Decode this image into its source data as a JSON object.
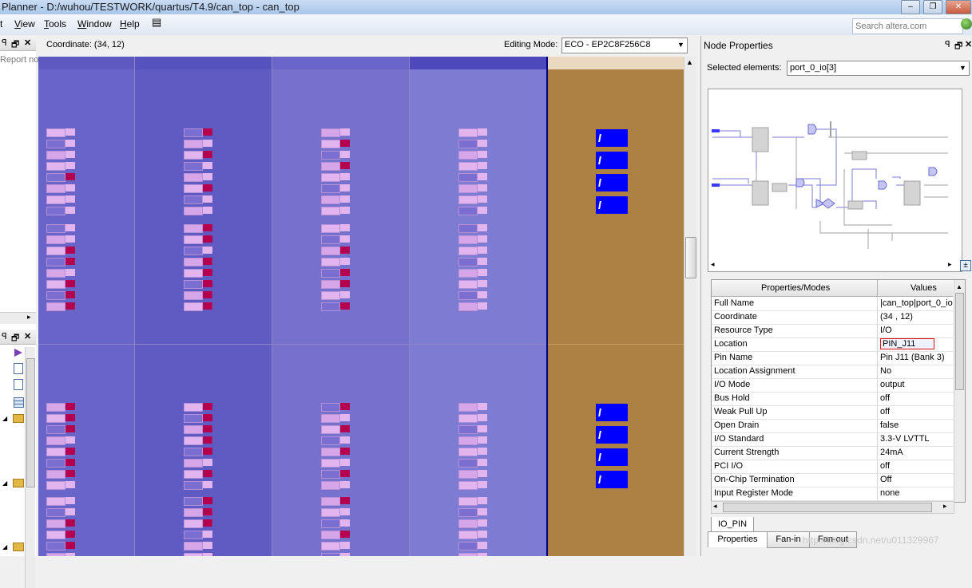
{
  "window": {
    "title": "Planner - D:/wuhou/TESTWORK/quartus/T4.9/can_top - can_top"
  },
  "menu": [
    {
      "prefix": "t",
      "label": ""
    },
    {
      "label": "View",
      "ul": "V",
      "rest": "iew"
    },
    {
      "label": "Tools",
      "ul": "T",
      "rest": "ools"
    },
    {
      "label": "Window",
      "ul": "W",
      "rest": "indow"
    },
    {
      "label": "Help",
      "ul": "H",
      "rest": "elp"
    }
  ],
  "menu_labels": {
    "m0": "t",
    "view_ul": "V",
    "view_rest": "iew",
    "tools_ul": "T",
    "tools_rest": "ools",
    "window_ul": "W",
    "window_rest": "indow",
    "help_ul": "H",
    "help_rest": "elp"
  },
  "search": {
    "placeholder": "Search altera.com"
  },
  "left_panel": {
    "report_text": "Report no"
  },
  "toolbar": {
    "coordinate": "Coordinate: (34, 12)",
    "editing_mode_label": "Editing Mode:",
    "editing_mode_value": "ECO - EP2C8F256C8"
  },
  "node_properties": {
    "title": "Node Properties",
    "selected_label": "Selected elements:",
    "selected_value": "port_0_io[3]",
    "table_headers": {
      "props": "Properties/Modes",
      "values": "Values"
    },
    "rows": [
      {
        "k": "Full Name",
        "v": "|can_top|port_0_io"
      },
      {
        "k": "Coordinate",
        "v": "(34 , 12)"
      },
      {
        "k": "Resource Type",
        "v": "I/O"
      },
      {
        "k": "Location",
        "v": "PIN_J11"
      },
      {
        "k": "Pin Name",
        "v": "Pin J11 (Bank 3)"
      },
      {
        "k": "Location Assignment",
        "v": "No"
      },
      {
        "k": "I/O Mode",
        "v": "output"
      },
      {
        "k": "Bus Hold",
        "v": "off"
      },
      {
        "k": "Weak Pull Up",
        "v": "off"
      },
      {
        "k": "Open Drain",
        "v": "false"
      },
      {
        "k": "I/O Standard",
        "v": "3.3-V LVTTL"
      },
      {
        "k": "Current Strength",
        "v": "24mA"
      },
      {
        "k": "PCI I/O",
        "v": "off"
      },
      {
        "k": "On-Chip Termination",
        "v": "Off"
      },
      {
        "k": "Input Register Mode",
        "v": "none"
      }
    ],
    "inner_tab": "IO_PIN",
    "bottom_tabs": {
      "properties": "Properties",
      "fanin": "Fan-in",
      "fanout": "Fan-out"
    },
    "watermark": "http://blog.csdn.net/u011329967"
  },
  "colors": {
    "chip_bg": "#6a66c9",
    "io_column": "#ad8144",
    "io_pad": "#0000ff",
    "selected_cell": "#b4004e",
    "cell_light": "#e3b5ef"
  }
}
